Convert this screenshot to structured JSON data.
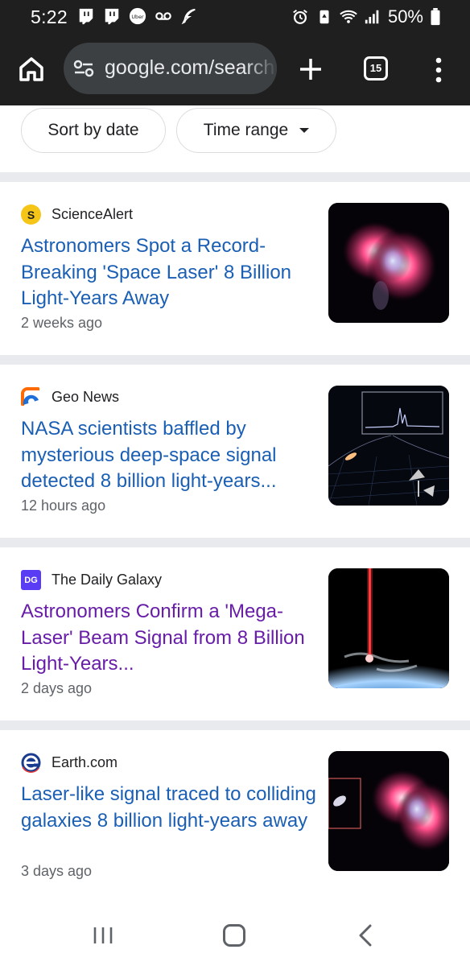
{
  "status": {
    "time": "5:22",
    "battery": "50%",
    "left_icons": [
      "twitch-icon",
      "twitch-icon",
      "uber-icon",
      "voicemail-icon",
      "feather-icon"
    ],
    "right_icons": [
      "alarm-icon",
      "recycle-icon",
      "wifi-icon",
      "signal-icon",
      "battery-icon"
    ]
  },
  "toolbar": {
    "url": "google.com/search",
    "tab_count": "15"
  },
  "filters": {
    "sort_label": "Sort by date",
    "time_label": "Time range"
  },
  "results": [
    {
      "source": "ScienceAlert",
      "favicon_text": "S",
      "favicon_bg": "#f5c518",
      "favicon_fg": "#1f1f1f",
      "title": "Astronomers Spot a Record-Breaking 'Space Laser' 8 Billion Light-Years Away",
      "age": "2 weeks ago",
      "visited": false
    },
    {
      "source": "Geo News",
      "favicon_text": "",
      "favicon_bg": "#ff6a00",
      "favicon_fg": "#ffffff",
      "title": "NASA scientists baffled by mysterious deep-space signal detected 8 billion light-years...",
      "age": "12 hours ago",
      "visited": false
    },
    {
      "source": "The Daily Galaxy",
      "favicon_text": "DG",
      "favicon_bg": "#5b3cf5",
      "favicon_fg": "#ffffff",
      "title": "Astronomers Confirm a 'Mega-Laser' Beam Signal from 8 Billion Light-Years...",
      "age": "2 days ago",
      "visited": true
    },
    {
      "source": "Earth.com",
      "favicon_text": "e",
      "favicon_bg": "#1a3c8f",
      "favicon_fg": "#ffffff",
      "title": "Laser-like signal traced to colliding galaxies 8 billion light-years away",
      "age": "3 days ago",
      "visited": false
    }
  ],
  "colors": {
    "link": "#1a5fb4",
    "visited": "#681da8",
    "meta": "#5f6368",
    "toolbar_bg": "#1f1f1f"
  }
}
